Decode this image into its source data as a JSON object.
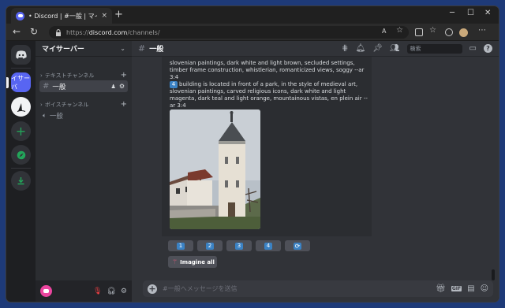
{
  "browser": {
    "tab_title": "• Discord | #一般 | マイサーバー",
    "tab_close": "×",
    "new_tab": "+",
    "url_prefix": "https://",
    "url_domain": "discord.com",
    "url_path": "/channels/",
    "window_controls": {
      "minimize": "─",
      "maximize": "☐",
      "close": "✕"
    }
  },
  "guilds": {
    "server_label": "イサーバ"
  },
  "sidebar": {
    "server_name": "マイサーバー",
    "text_category": "テキストチャンネル",
    "voice_category": "ボイスチャンネル",
    "text_channel": "一般",
    "voice_channel": "一般"
  },
  "header": {
    "channel_name": "一般",
    "search_placeholder": "検索"
  },
  "message": {
    "prompt_prev": "slovenian paintings, dark white and light brown, secluded settings, timber frame construction, whistlerian, romanticized views, soggy --ar 3:4",
    "prompt_num": "4",
    "prompt_4": "building is located in front of a park, in the style of medieval art, slovenian paintings, carved religious icons, dark white and light magenta, dark teal and light orange, mountainous vistas, en plein air --ar 3:4"
  },
  "buttons": {
    "u1": "1",
    "u2": "2",
    "u3": "3",
    "u4": "4",
    "reroll_icon": "reroll-icon",
    "imagine_all": "Imagine all"
  },
  "composer": {
    "placeholder": "#一般へメッセージを送信"
  },
  "colors": {
    "blurple": "#5865f2",
    "green": "#23a55a",
    "keycap": "#3b82c4",
    "button": "#4e5058"
  }
}
